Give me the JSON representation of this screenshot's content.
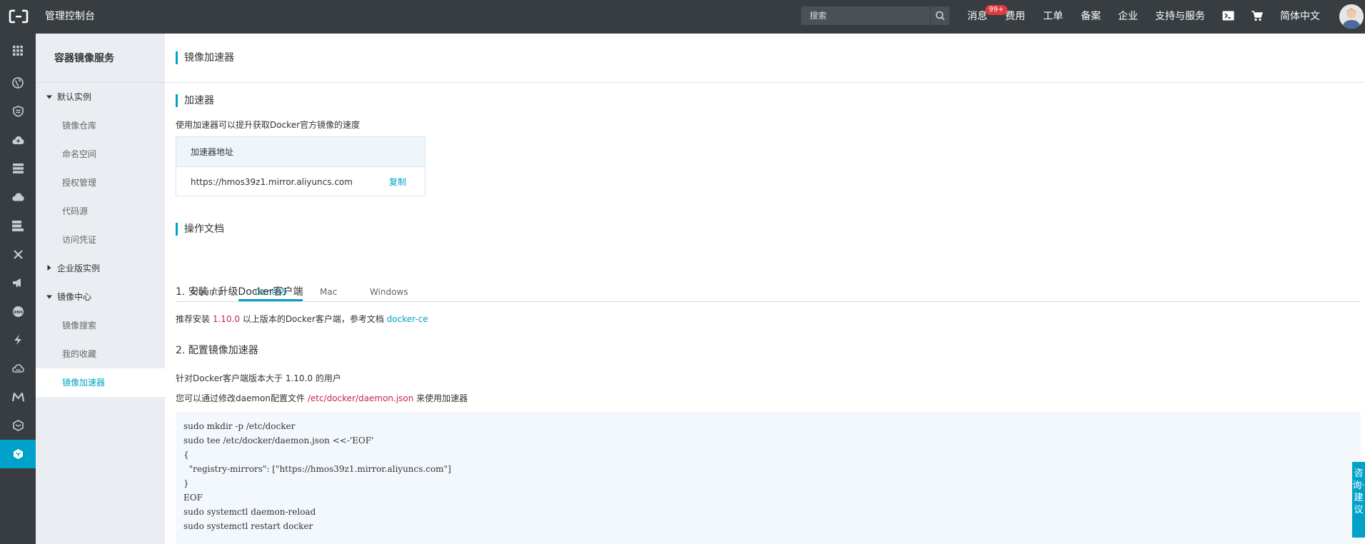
{
  "topbar": {
    "title": "管理控制台",
    "search_placeholder": "搜索",
    "nav": [
      {
        "label": "消息"
      },
      {
        "label": "费用"
      },
      {
        "label": "工单"
      },
      {
        "label": "备案"
      },
      {
        "label": "企业"
      },
      {
        "label": "支持与服务"
      },
      {
        "label": "简体中文"
      }
    ],
    "badge": "99+"
  },
  "rail_icons": [
    "apps-grid-icon",
    "globe-icon",
    "shield-icon",
    "cloud-upload-icon",
    "server-icon",
    "cloud-icon",
    "database-icon",
    "network-icon",
    "megaphone-icon",
    "dns-icon",
    "lightning-icon",
    "cloud-storage-icon",
    "m-icon",
    "container-icon",
    "container-registry-icon"
  ],
  "sidebar": {
    "title": "容器镜像服务",
    "groups": [
      {
        "label": "默认实例",
        "items": [
          "镜像仓库",
          "命名空间",
          "授权管理",
          "代码源",
          "访问凭证"
        ]
      },
      {
        "label": "企业版实例"
      },
      {
        "label": "镜像中心",
        "items": [
          "镜像搜索",
          "我的收藏",
          "镜像加速器"
        ]
      }
    ]
  },
  "main": {
    "page_title": "镜像加速器",
    "accelerator": {
      "title": "加速器",
      "desc": "使用加速器可以提升获取Docker官方镜像的速度",
      "box_header": "加速器地址",
      "url": "https://hmos39z1.mirror.aliyuncs.com",
      "copy": "复制"
    },
    "docs": {
      "title": "操作文档",
      "tabs": [
        "Ubuntu",
        "CentOS",
        "Mac",
        "Windows"
      ],
      "active_tab": "CentOS"
    },
    "step1": {
      "title": "1. 安装 / 升级Docker客户端",
      "text_a": "推荐安装 ",
      "version": "1.10.0",
      "text_b": " 以上版本的Docker客户端，参考文档 ",
      "link": "docker-ce"
    },
    "step2": {
      "title": "2. 配置镜像加速器",
      "line1": "针对Docker客户端版本大于 1.10.0 的用户",
      "line2_a": "您可以通过修改daemon配置文件 ",
      "line2_path": "/etc/docker/daemon.json",
      "line2_b": " 来使用加速器",
      "code": "sudo mkdir -p /etc/docker\nsudo tee /etc/docker/daemon.json <<-'EOF'\n{\n  \"registry-mirrors\": [\"https://hmos39z1.mirror.aliyuncs.com\"]\n}\nEOF\nsudo systemctl daemon-reload\nsudo systemctl restart docker"
    }
  },
  "feedback": "咨询·建议",
  "colors": {
    "accent": "#00a2ca",
    "topbar": "#373d41",
    "badge": "#e4393c",
    "code_red": "#c7254e"
  }
}
